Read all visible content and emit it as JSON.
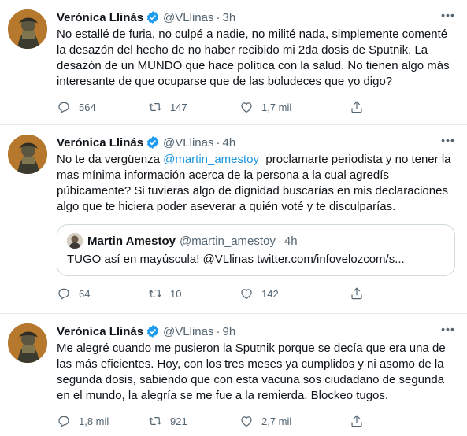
{
  "tweets": [
    {
      "name": "Verónica Llinás",
      "handle": "@VLlinas",
      "time": "3h",
      "text": "No estallé de furia, no culpé a nadie, no milité nada, simplemente comenté la desazón del hecho de no haber recibido mi 2da dosis de Sputnik. La desazón de un MUNDO que hace política con la salud. No tienen algo más interesante de que ocuparse que de las boludeces que yo digo?",
      "replies": "564",
      "retweets": "147",
      "likes": "1,7 mil"
    },
    {
      "name": "Verónica Llinás",
      "handle": "@VLlinas",
      "time": "4h",
      "text_before": "No te da vergüenza ",
      "mention": "@martin_amestoy",
      "text_after": "  proclamarte periodista y no tener la mas mínima información acerca de la persona a la cual agredís púbicamente? Si tuvieras algo de dignidad buscarías en mis declaraciones algo que te hiciera poder aseverar a quién voté y te disculparías.",
      "quote": {
        "name": "Martin Amestoy",
        "handle": "@martin_amestoy",
        "time": "4h",
        "text": "TUGO así en mayúscula! @VLlinas twitter.com/infovelozcom/s..."
      },
      "replies": "64",
      "retweets": "10",
      "likes": "142"
    },
    {
      "name": "Verónica Llinás",
      "handle": "@VLlinas",
      "time": "9h",
      "text": "Me alegré cuando me pusieron la Sputnik porque se decía que era una de las más eficientes. Hoy, con los tres meses ya cumplidos y ni asomo de la segunda dosis, sabiendo que con esta vacuna sos ciudadano de segunda en el mundo, la alegría se me fue a la remierda. Blockeo tugos.",
      "replies": "1,8 mil",
      "retweets": "921",
      "likes": "2,7 mil"
    }
  ],
  "separator": "·",
  "colors": {
    "accent": "#1b95e0",
    "secondary_text": "#536471",
    "border": "#e6ecf0"
  }
}
